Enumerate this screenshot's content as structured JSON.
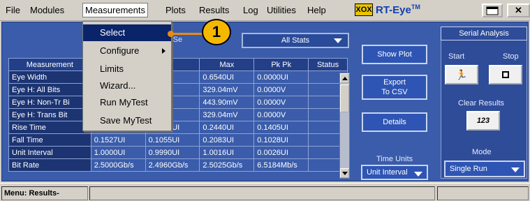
{
  "menubar": {
    "items": [
      "File",
      "Modules",
      "Measurements",
      "Plots",
      "Results",
      "Log",
      "Utilities",
      "Help"
    ],
    "active": "Measurements",
    "logo_mark": "XOX",
    "app_name": "RT-Eye",
    "trademark": "TM"
  },
  "menu": {
    "items": [
      {
        "label": "Select",
        "selected": true,
        "submenu": false
      },
      {
        "label": "Configure",
        "selected": false,
        "submenu": true
      },
      {
        "label": "Limits",
        "selected": false,
        "submenu": false
      },
      {
        "label": "Wizard...",
        "selected": false,
        "submenu": false
      },
      {
        "label": "Run MyTest",
        "selected": false,
        "submenu": false
      },
      {
        "label": "Save MyTest",
        "selected": false,
        "submenu": false
      }
    ]
  },
  "callout": {
    "number": "1",
    "color": "#f5b800"
  },
  "filter": {
    "label_fragment": "y: Se",
    "stats_value": "All Stats"
  },
  "table": {
    "headers": [
      "Measurement",
      "",
      "Max",
      "Pk Pk",
      "Status"
    ],
    "rows": [
      [
        "Eye Width",
        "",
        "UI",
        "0.6540UI",
        "0.0000UI",
        ""
      ],
      [
        "Eye H: All Bits",
        "",
        "mV",
        "329.04mV",
        "0.0000V",
        ""
      ],
      [
        "Eye H: Non-Tr Bi",
        "",
        "mV",
        "443.90mV",
        "0.0000V",
        ""
      ],
      [
        "Eye H: Trans Bit",
        "",
        "mV",
        "329.04mV",
        "0.0000V",
        ""
      ],
      [
        "Rise Time",
        "0.1586UI",
        "0.1034UI",
        "0.2440UI",
        "0.1405UI",
        ""
      ],
      [
        "Fall Time",
        "0.1527UI",
        "0.1055UI",
        "0.2083UI",
        "0.1028UI",
        ""
      ],
      [
        "Unit Interval",
        "1.0000UI",
        "0.9990UI",
        "1.0016UI",
        "0.0026UI",
        ""
      ],
      [
        "Bit Rate",
        "2.5000Gb/s",
        "2.4960Gb/s",
        "2.5025Gb/s",
        "6.5184Mb/s",
        ""
      ]
    ]
  },
  "buttons": {
    "show_plot": "Show Plot",
    "export_line1": "Export",
    "export_line2": "To CSV",
    "details": "Details",
    "time_units_label": "Time Units",
    "time_units_value": "Unit Interval"
  },
  "serial": {
    "title": "Serial Analysis",
    "start_label": "Start",
    "stop_label": "Stop",
    "clear_label": "Clear Results",
    "clear_icon_text": "123",
    "mode_label": "Mode",
    "mode_value": "Single Run"
  },
  "status": {
    "text": "Menu: Results->Summ..."
  }
}
